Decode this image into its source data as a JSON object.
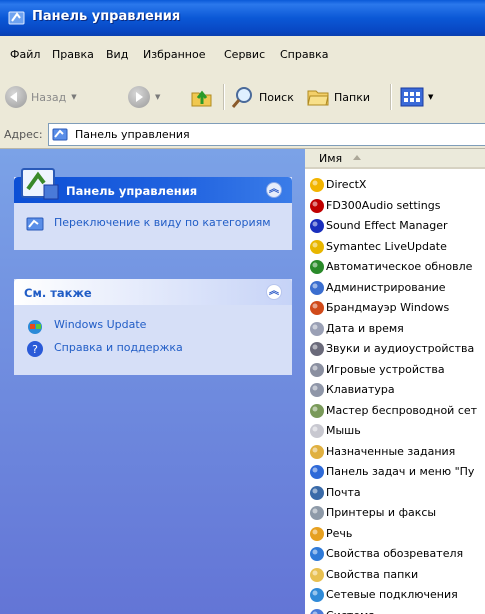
{
  "window": {
    "title": "Панель управления"
  },
  "menu": [
    "Файл",
    "Правка",
    "Вид",
    "Избранное",
    "Сервис",
    "Справка"
  ],
  "toolbar": {
    "back_label": "Назад",
    "search_label": "Поиск",
    "folders_label": "Папки"
  },
  "address": {
    "label": "Адрес:",
    "value": "Панель управления"
  },
  "left_pane": {
    "control_panel": {
      "title": "Панель управления",
      "link": "Переключение к виду по категориям"
    },
    "see_also": {
      "title": "См. также",
      "links": [
        "Windows Update",
        "Справка и поддержка"
      ]
    }
  },
  "file_list": {
    "column_header": "Имя",
    "items": [
      {
        "name": "DirectX",
        "icon": "directx-icon",
        "color": "#f2b400"
      },
      {
        "name": "FD300Audio settings",
        "icon": "fd300-icon",
        "color": "#c00000"
      },
      {
        "name": "Sound Effect Manager",
        "icon": "sound-effect-icon",
        "color": "#1a2fbd"
      },
      {
        "name": "Symantec LiveUpdate",
        "icon": "liveupdate-icon",
        "color": "#e8b600"
      },
      {
        "name": "Автоматическое обновле",
        "icon": "auto-update-icon",
        "color": "#2a8a2a"
      },
      {
        "name": "Администрирование",
        "icon": "admin-tools-icon",
        "color": "#3b6ecf"
      },
      {
        "name": "Брандмауэр Windows",
        "icon": "firewall-icon",
        "color": "#d04a1a"
      },
      {
        "name": "Дата и время",
        "icon": "datetime-icon",
        "color": "#9aa0b5"
      },
      {
        "name": "Звуки и аудиоустройства",
        "icon": "sounds-icon",
        "color": "#6a6a7a"
      },
      {
        "name": "Игровые устройства",
        "icon": "game-controller-icon",
        "color": "#8a8fa0"
      },
      {
        "name": "Клавиатура",
        "icon": "keyboard-icon",
        "color": "#8f96a8"
      },
      {
        "name": "Мастер беспроводной сет",
        "icon": "wireless-wizard-icon",
        "color": "#7a9a5a"
      },
      {
        "name": "Мышь",
        "icon": "mouse-icon",
        "color": "#c8c8d0"
      },
      {
        "name": "Назначенные задания",
        "icon": "scheduled-tasks-icon",
        "color": "#e0b040"
      },
      {
        "name": "Панель задач и меню \"Пу",
        "icon": "taskbar-icon",
        "color": "#2f6ad8"
      },
      {
        "name": "Почта",
        "icon": "mail-icon",
        "color": "#3a6aa8"
      },
      {
        "name": "Принтеры и факсы",
        "icon": "printers-icon",
        "color": "#8e9aa8"
      },
      {
        "name": "Речь",
        "icon": "speech-icon",
        "color": "#e6a020"
      },
      {
        "name": "Свойства обозревателя",
        "icon": "internet-options-icon",
        "color": "#2f7ad8"
      },
      {
        "name": "Свойства папки",
        "icon": "folder-options-icon",
        "color": "#e8c050"
      },
      {
        "name": "Сетевые подключения",
        "icon": "network-connections-icon",
        "color": "#2f8ad8"
      },
      {
        "name": "Система",
        "icon": "system-icon",
        "color": "#4a7ad8"
      }
    ]
  }
}
